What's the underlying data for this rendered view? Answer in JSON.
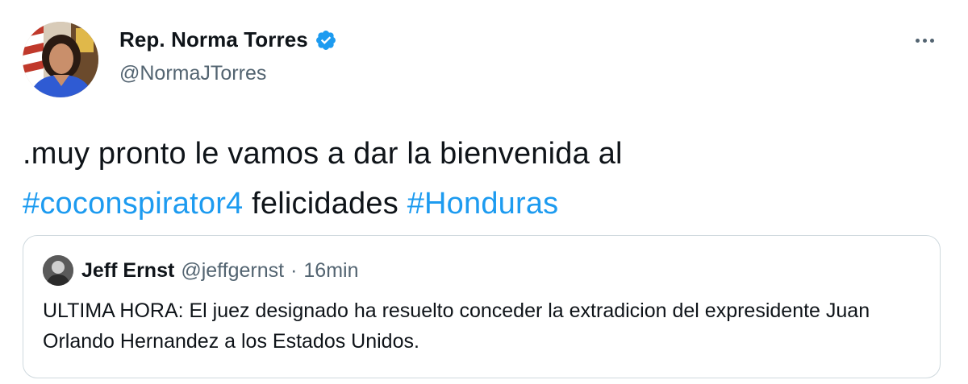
{
  "author": {
    "display_name": "Rep. Norma Torres",
    "handle": "@NormaJTorres",
    "verified_icon": "verified-badge-icon",
    "avatar_icon": "profile-photo"
  },
  "menu": {
    "more_icon": "more-options-icon"
  },
  "tweet": {
    "text_line1": ".muy pronto le vamos a dar la bienvenida al",
    "hashtag1": "#coconspirator4",
    "text_mid": "felicidades",
    "hashtag2": "#Honduras"
  },
  "quote": {
    "display_name": "Jeff Ernst",
    "handle": "@jeffgernst",
    "separator": "·",
    "time": "16min",
    "text": "ULTIMA HORA: El juez designado ha resuelto conceder la extradicion del expresidente Juan Orlando Hernandez a los Estados Unidos."
  },
  "colors": {
    "accent": "#1d9bf0",
    "text_primary": "#0f1419",
    "text_secondary": "#536471",
    "border": "#cfd9de"
  }
}
